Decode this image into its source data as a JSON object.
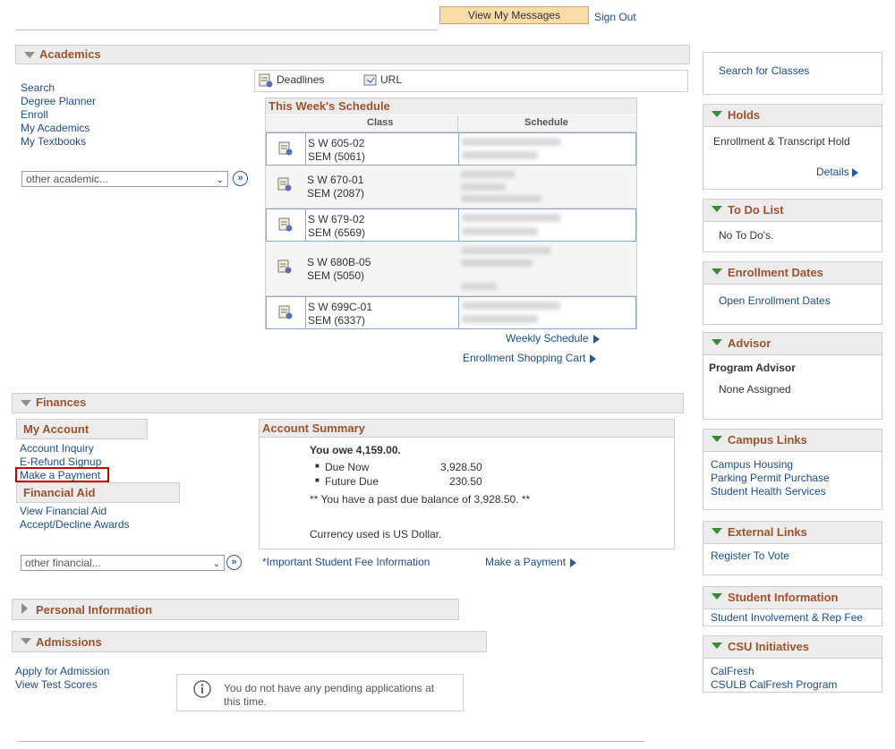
{
  "top": {
    "messages_button": "View My Messages",
    "signout": "Sign Out"
  },
  "academics": {
    "title": "Academics",
    "links": [
      "Search",
      "Degree Planner",
      "Enroll",
      "My Academics",
      "My Textbooks"
    ],
    "select_value": "other academic...",
    "tabs": {
      "deadlines": "Deadlines",
      "url": "URL"
    },
    "schedule": {
      "title": "This Week's Schedule",
      "headers": [
        "Class",
        "Schedule"
      ],
      "rows": [
        {
          "code": "S W 605-02",
          "section": "SEM (5061)"
        },
        {
          "code": "S W 670-01",
          "section": "SEM (2087)"
        },
        {
          "code": "S W 679-02",
          "section": "SEM (6569)"
        },
        {
          "code": "S W 680B-05",
          "section": "SEM (5050)"
        },
        {
          "code": "S W 699C-01",
          "section": "SEM (6337)"
        }
      ],
      "weekly_link": "Weekly Schedule",
      "cart_link": "Enrollment Shopping Cart"
    }
  },
  "finances": {
    "title": "Finances",
    "my_account": {
      "title": "My Account",
      "links": [
        "Account Inquiry",
        "E-Refund Signup",
        "Make a Payment"
      ]
    },
    "financial_aid": {
      "title": "Financial Aid",
      "links": [
        "View Financial Aid",
        "Accept/Decline Awards"
      ]
    },
    "select_value": "other financial...",
    "summary": {
      "title": "Account Summary",
      "you_owe": "You owe 4,159.00.",
      "due_now_label": "Due Now",
      "due_now_value": "3,928.50",
      "future_due_label": "Future Due",
      "future_due_value": "230.50",
      "past_due": "** You have a past due balance of 3,928.50. **",
      "currency": "Currency used is US Dollar."
    },
    "fee_info_link": "*Important Student Fee Information",
    "payment_link": "Make a Payment"
  },
  "personal": {
    "title": "Personal Information"
  },
  "admissions": {
    "title": "Admissions",
    "links": [
      "Apply for Admission",
      "View Test Scores"
    ],
    "notice": "You do not have any pending applications at this time."
  },
  "sidebar": {
    "search_classes": "Search for Classes",
    "holds": {
      "title": "Holds",
      "item": "Enrollment & Transcript Hold",
      "details": "Details"
    },
    "todo": {
      "title": "To Do List",
      "item": "No To Do's."
    },
    "enroll_dates": {
      "title": "Enrollment Dates",
      "link": "Open Enrollment Dates"
    },
    "advisor": {
      "title": "Advisor",
      "label": "Program Advisor",
      "value": "None Assigned"
    },
    "campus_links": {
      "title": "Campus Links",
      "links": [
        "Campus Housing",
        "Parking Permit Purchase",
        "Student Health Services"
      ]
    },
    "external_links": {
      "title": "External Links",
      "links": [
        "Register To Vote"
      ]
    },
    "student_info": {
      "title": "Student Information",
      "links": [
        "Student Involvement & Rep Fee"
      ]
    },
    "csu": {
      "title": "CSU Initiatives",
      "links": [
        "CalFresh",
        "CSULB CalFresh Program"
      ]
    }
  },
  "colors": {
    "section_title": "#a0522d",
    "link": "#1a4d8c",
    "highlight_box": "#cc0000",
    "button_bg": "#f7dca8"
  }
}
